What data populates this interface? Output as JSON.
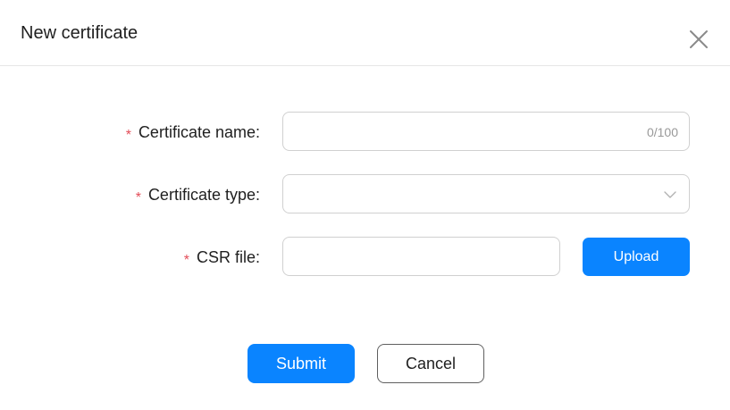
{
  "dialog": {
    "title": "New certificate",
    "close_icon": "close-icon"
  },
  "form": {
    "required_mark": "*",
    "certificate_name": {
      "label": "Certificate name:",
      "value": "",
      "counter": "0/100"
    },
    "certificate_type": {
      "label": "Certificate type:",
      "value": "",
      "icon": "chevron-down-icon"
    },
    "csr_file": {
      "label": "CSR file:",
      "value": "",
      "upload_label": "Upload"
    }
  },
  "actions": {
    "submit_label": "Submit",
    "cancel_label": "Cancel"
  },
  "colors": {
    "accent": "#0a84ff",
    "required": "#e34d59",
    "border": "#d0d0d0",
    "counter": "#999999"
  }
}
